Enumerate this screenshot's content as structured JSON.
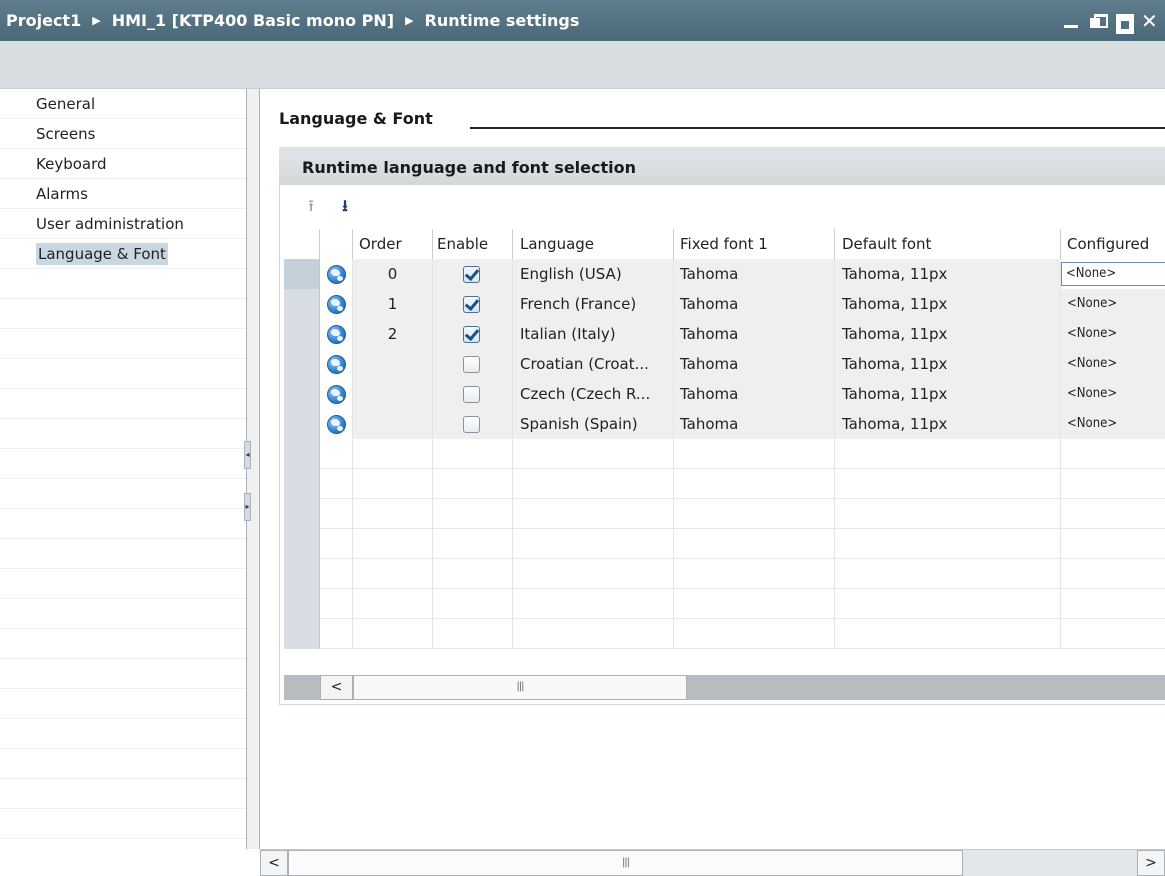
{
  "titlebar": {
    "crumbs": [
      "Project1",
      "HMI_1 [KTP400 Basic mono PN]",
      "Runtime settings"
    ],
    "separator": "▶"
  },
  "sidebar": {
    "items": [
      {
        "label": "General",
        "active": false
      },
      {
        "label": "Screens",
        "active": false
      },
      {
        "label": "Keyboard",
        "active": false
      },
      {
        "label": "Alarms",
        "active": false
      },
      {
        "label": "User administration",
        "active": false
      },
      {
        "label": "Language & Font",
        "active": true
      }
    ]
  },
  "main": {
    "section_title": "Language & Font",
    "group_title": "Runtime language and font selection",
    "toolbar": {
      "move_up_icon": "arrow-up-icon",
      "move_down_icon": "arrow-down-icon"
    },
    "table": {
      "headers": [
        "Order",
        "Enable",
        "Language",
        "Fixed font 1",
        "Default font",
        "Configured"
      ],
      "rows": [
        {
          "order": "0",
          "enabled": true,
          "language": "English (USA)",
          "fixed_font": "Tahoma",
          "default_font": "Tahoma, 11px",
          "configured": "<None>"
        },
        {
          "order": "1",
          "enabled": true,
          "language": "French (France)",
          "fixed_font": "Tahoma",
          "default_font": "Tahoma, 11px",
          "configured": "<None>"
        },
        {
          "order": "2",
          "enabled": true,
          "language": "Italian (Italy)",
          "fixed_font": "Tahoma",
          "default_font": "Tahoma, 11px",
          "configured": "<None>"
        },
        {
          "order": "",
          "enabled": false,
          "language": "Croatian (Croat...",
          "fixed_font": "Tahoma",
          "default_font": "Tahoma, 11px",
          "configured": "<None>"
        },
        {
          "order": "",
          "enabled": false,
          "language": "Czech (Czech R...",
          "fixed_font": "Tahoma",
          "default_font": "Tahoma, 11px",
          "configured": "<None>"
        },
        {
          "order": "",
          "enabled": false,
          "language": "Spanish (Spain)",
          "fixed_font": "Tahoma",
          "default_font": "Tahoma, 11px",
          "configured": "<None>"
        }
      ]
    }
  },
  "colors": {
    "titlebar": "#4f6d7e",
    "selection": "#c9d7e3",
    "check": "#1b4f8a"
  }
}
